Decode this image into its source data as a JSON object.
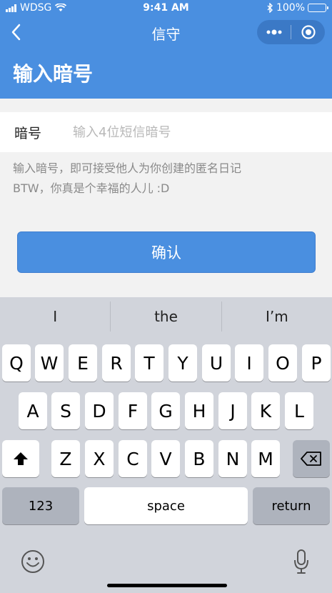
{
  "status_bar": {
    "carrier": "WDSG",
    "time": "9:41 AM",
    "battery": "100%"
  },
  "nav": {
    "title": "信守"
  },
  "header": {
    "title": "输入暗号"
  },
  "form": {
    "label": "暗号",
    "placeholder": "输入4位短信暗号",
    "value": ""
  },
  "hint": {
    "line1": "输入暗号，即可接受他人为你创建的匿名日记",
    "line2": "BTW，你真是个幸福的人儿 :D"
  },
  "confirm_button": {
    "label": "确认"
  },
  "keyboard": {
    "suggestions": [
      "I",
      "the",
      "I’m"
    ],
    "row1": [
      "Q",
      "W",
      "E",
      "R",
      "T",
      "Y",
      "U",
      "I",
      "O",
      "P"
    ],
    "row2": [
      "A",
      "S",
      "D",
      "F",
      "G",
      "H",
      "J",
      "K",
      "L"
    ],
    "row3": [
      "Z",
      "X",
      "C",
      "V",
      "B",
      "N",
      "M"
    ],
    "numbers_label": "123",
    "space_label": "space",
    "return_label": "return"
  },
  "icons": {
    "back": "chevron-left-icon",
    "more": "more-dots-icon",
    "close": "close-circle-icon",
    "shift": "shift-icon",
    "delete": "backspace-icon",
    "emoji": "emoji-icon",
    "mic": "microphone-icon"
  }
}
